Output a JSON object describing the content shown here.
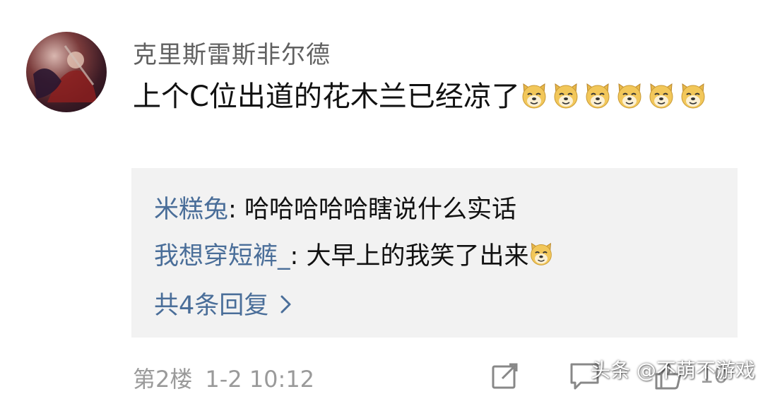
{
  "comment": {
    "username": "克里斯雷斯非尔德",
    "text": "上个C位出道的花木兰已经凉了",
    "emoji_icon": "doge-emoji-icon",
    "emoji_count": 6
  },
  "replies": [
    {
      "user": "米糕兔",
      "sep": ": ",
      "text": "哈哈哈哈哈瞎说什么实话"
    },
    {
      "user": "我想穿短裤_",
      "sep": ": ",
      "text": "大早上的我笑了出来"
    }
  ],
  "more_replies": "共4条回复",
  "meta": {
    "floor": "第2楼",
    "time": "1-2 10:12"
  },
  "actions": {
    "share_icon": "share-icon",
    "comment_icon": "comment-icon",
    "like_icon": "like-icon",
    "count": "10"
  },
  "watermark": "头条 @不萌不游戏",
  "colors": {
    "username": "#606060",
    "reply_user": "#4a6e99",
    "reply_bg": "#f2f2f2",
    "meta": "#9a9a9a"
  }
}
